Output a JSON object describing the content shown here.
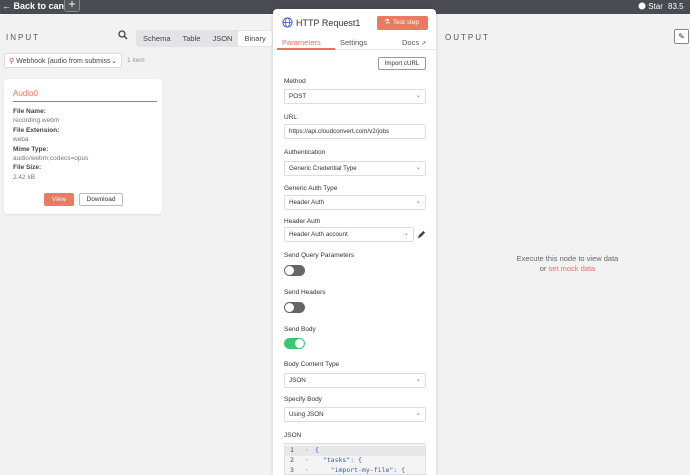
{
  "topbar": {
    "back_label": "Back to canvas",
    "add_label": "+",
    "star_label": "Star",
    "star_count": "83.5"
  },
  "input": {
    "label": "INPUT",
    "tabs": [
      "Schema",
      "Table",
      "JSON",
      "Binary"
    ],
    "active_tab": "Binary",
    "node_select": "Webhook (audio from submiss",
    "item_count": "1 item",
    "card": {
      "title": "Audio0",
      "fields": [
        {
          "key": "File Name:",
          "value": "recording.webm"
        },
        {
          "key": "File Extension:",
          "value": "weba"
        },
        {
          "key": "Mime Type:",
          "value": "audio/webm;codecs=opus"
        },
        {
          "key": "File Size:",
          "value": "2.42 kB"
        }
      ],
      "view_label": "View",
      "download_label": "Download"
    }
  },
  "node": {
    "title": "HTTP Request1",
    "test_label": "Test step",
    "tabs": {
      "parameters": "Parameters",
      "settings": "Settings",
      "docs": "Docs"
    },
    "import_label": "Import cURL",
    "method_label": "Method",
    "method_value": "POST",
    "url_label": "URL",
    "url_value": "https://api.cloudconvert.com/v2/jobs",
    "auth_label": "Authentication",
    "auth_value": "Generic Credential Type",
    "generic_label": "Generic Auth Type",
    "generic_value": "Header Auth",
    "header_auth_label": "Header Auth",
    "header_auth_value": "Header Auth account",
    "send_query_label": "Send Query Parameters",
    "send_query_on": false,
    "send_headers_label": "Send Headers",
    "send_headers_on": false,
    "send_body_label": "Send Body",
    "send_body_on": true,
    "content_type_label": "Body Content Type",
    "content_type_value": "JSON",
    "specify_label": "Specify Body",
    "specify_value": "Using JSON",
    "json_label": "JSON",
    "code_lines": [
      {
        "num": "1",
        "fold": "⌄",
        "text": "{"
      },
      {
        "num": "2",
        "fold": "⌄",
        "text": "  \"tasks\": {"
      },
      {
        "num": "3",
        "fold": "⌄",
        "text": "    \"import-my-file\": {"
      }
    ]
  },
  "output": {
    "label": "OUTPUT",
    "message": "Execute this node to view data",
    "or_text": "or",
    "link": "set mock data"
  },
  "colors": {
    "accent": "#ea7a62",
    "toggle_on": "#3ec66e",
    "toggle_off": "#666666"
  }
}
